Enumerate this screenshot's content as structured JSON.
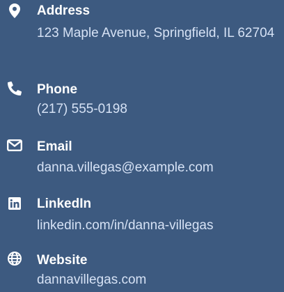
{
  "theme": {
    "background": "#3d5a80",
    "label_color": "#ffffff",
    "value_color": "#d6e2f5"
  },
  "contact": {
    "address": {
      "icon": "map-pin-icon",
      "label": "Address",
      "value": "123 Maple Avenue, Springfield, IL 62704"
    },
    "phone": {
      "icon": "phone-icon",
      "label": "Phone",
      "value": "(217) 555-0198"
    },
    "email": {
      "icon": "envelope-icon",
      "label": "Email",
      "value": "danna.villegas@example.com"
    },
    "linkedin": {
      "icon": "linkedin-icon",
      "label": "LinkedIn",
      "value": "linkedin.com/in/danna-villegas"
    },
    "website": {
      "icon": "globe-icon",
      "label": "Website",
      "value": "dannavillegas.com"
    }
  }
}
